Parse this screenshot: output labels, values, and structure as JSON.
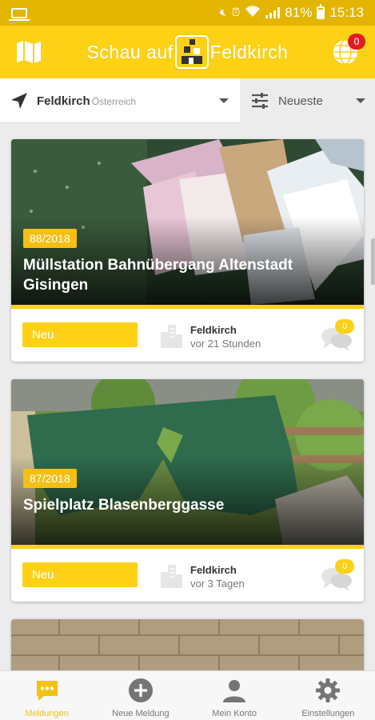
{
  "status_bar": {
    "battery": "81%",
    "time": "15:13",
    "icons": [
      "laptop-icon",
      "mute-icon",
      "alarm-icon",
      "wifi-icon",
      "signal-icon",
      "battery-icon"
    ]
  },
  "app_bar": {
    "title_left": "Schau auf",
    "title_right": "Feldkirch",
    "notification_count": "0",
    "colors": {
      "primary": "#fcd116",
      "status_bar": "#e3b500",
      "badge": "#e11d23"
    }
  },
  "filters": {
    "location_city": "Feldkirch",
    "location_country": "Österreich",
    "sort_label": "Neueste"
  },
  "reports": [
    {
      "number": "88/2018",
      "title": "Müllstation Bahnübergang Altenstadt Gisingen",
      "status": "Neu",
      "city": "Feldkirch",
      "time": "vor 21 Stunden",
      "comments": "0"
    },
    {
      "number": "87/2018",
      "title": "Spielplatz Blasenberggasse",
      "status": "Neu",
      "city": "Feldkirch",
      "time": "vor 3 Tagen",
      "comments": "0"
    }
  ],
  "bottom_nav": [
    {
      "label": "Meldungen",
      "icon": "chat-bubble-icon",
      "active": true
    },
    {
      "label": "Neue Meldung",
      "icon": "add-circle-icon",
      "active": false
    },
    {
      "label": "Mein Konto",
      "icon": "person-icon",
      "active": false
    },
    {
      "label": "Einstellungen",
      "icon": "gear-icon",
      "active": false
    }
  ]
}
